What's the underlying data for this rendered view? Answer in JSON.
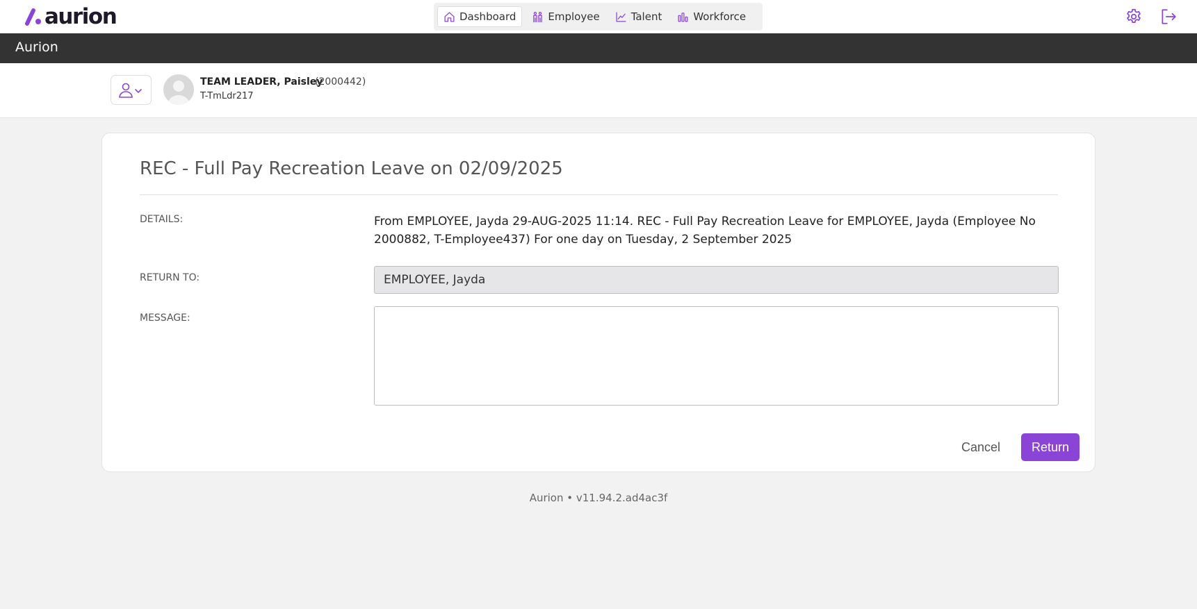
{
  "brand": {
    "logo_text": "aurion",
    "accent": "#8b45d6"
  },
  "nav": {
    "tabs": [
      {
        "label": "Dashboard",
        "icon": "home-icon",
        "active": true
      },
      {
        "label": "Employee",
        "icon": "people-icon",
        "active": false
      },
      {
        "label": "Talent",
        "icon": "trend-chart-icon",
        "active": false
      },
      {
        "label": "Workforce",
        "icon": "bar-chart-icon",
        "active": false
      }
    ],
    "settings_icon": "gear-icon",
    "logout_icon": "logout-icon"
  },
  "appbar": {
    "title": "Aurion"
  },
  "user": {
    "name": "TEAM LEADER, Paisley",
    "id": "(2000442)",
    "login": "T-TmLdr217"
  },
  "card": {
    "title": "REC - Full Pay Recreation Leave on 02/09/2025",
    "details_label": "DETAILS:",
    "details_text": "From EMPLOYEE, Jayda 29-AUG-2025 11:14. REC - Full Pay Recreation Leave for EMPLOYEE, Jayda (Employee No 2000882, T-Employee437) For one day on Tuesday, 2 September 2025",
    "return_to_label": "RETURN TO:",
    "return_to_value": "EMPLOYEE, Jayda",
    "message_label": "MESSAGE:",
    "message_value": "",
    "cancel_label": "Cancel",
    "return_label": "Return"
  },
  "footer": {
    "text": "Aurion • v11.94.2.ad4ac3f"
  }
}
